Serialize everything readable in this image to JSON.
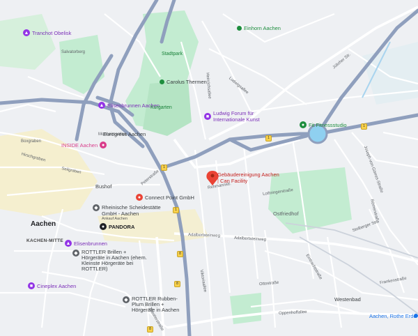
{
  "map": {
    "city": "Aachen",
    "districts": [
      "KACHEN-MITTE"
    ],
    "streets": [
      "Boxgraben",
      "Hirschgraben",
      "Seilgraben",
      "Peterstraße",
      "Monheimsallee",
      "Ludwigsallee",
      "Heinrichsallee",
      "Lothringerstraße",
      "Adalbertsteinweg",
      "Oppenhoffallee",
      "Jülicher Str.",
      "Joseph-von-Görres-Straße",
      "Stolberger Str.",
      "Eintrachtstraße",
      "Viktoriaallee",
      "Theaterstraße",
      "Salvatorberg",
      "Rehmannstr.",
      "Ottostraße",
      "Römerstraße",
      "Frankenstraße"
    ],
    "road_badges": [
      "1",
      "1",
      "1",
      "1",
      "8",
      "8",
      "8"
    ],
    "pois": [
      {
        "name": "Tranchot Obelisk",
        "kind": "landmark"
      },
      {
        "name": "Salvatorberg",
        "kind": "area"
      },
      {
        "name": "Stadtpark",
        "kind": "park"
      },
      {
        "name": "Carolus Thermen",
        "kind": "spa"
      },
      {
        "name": "Elisenbrunnen Aachen",
        "kind": "landmark"
      },
      {
        "name": "Kurgarten",
        "kind": "park"
      },
      {
        "name": "Ludwig Forum für Internationale Kunst",
        "kind": "museum"
      },
      {
        "name": "Einhorn Aachen",
        "kind": "landmark"
      },
      {
        "name": "INSIDE Aachen",
        "kind": "shop"
      },
      {
        "name": "Eurogress Aachen",
        "kind": "venue"
      },
      {
        "name": "Gebäudereinigung Aachen | Can Facility",
        "kind": "pin"
      },
      {
        "name": "Connect Point GmbH",
        "kind": "business"
      },
      {
        "name": "Rheinische Scheidestätte GmbH - Aachen",
        "kind": "business"
      },
      {
        "name": "Ankauf Aachen",
        "kind": "business"
      },
      {
        "name": "PANDORA",
        "kind": "shop"
      },
      {
        "name": "Elisenbrunnen",
        "kind": "landmark"
      },
      {
        "name": "ROTTLER Brillen + Hörgeräte in Aachen (ehem. Kleinste Hörgeräte bei ROTTLER)",
        "kind": "shop"
      },
      {
        "name": "Cineplex Aachen",
        "kind": "cinema"
      },
      {
        "name": "ROTTLER Rubben-Plum Brillen + Hörgeräte in Aachen",
        "kind": "shop"
      },
      {
        "name": "Ostfriedhof",
        "kind": "cemetery"
      },
      {
        "name": "Aachen, Rothe Erde (B)",
        "kind": "station"
      },
      {
        "name": "Fit Fitnessstudio",
        "kind": "gym"
      },
      {
        "name": "Westenbad",
        "kind": "pool"
      },
      {
        "name": "Bushof",
        "kind": "transit"
      }
    ],
    "colors": {
      "background": "#eef0f3",
      "park": "#c3ecd1",
      "road_major": "#8f9fbd",
      "road_minor": "#ffffff",
      "pin": "#ea4335",
      "rail": "#ccd2db"
    }
  }
}
